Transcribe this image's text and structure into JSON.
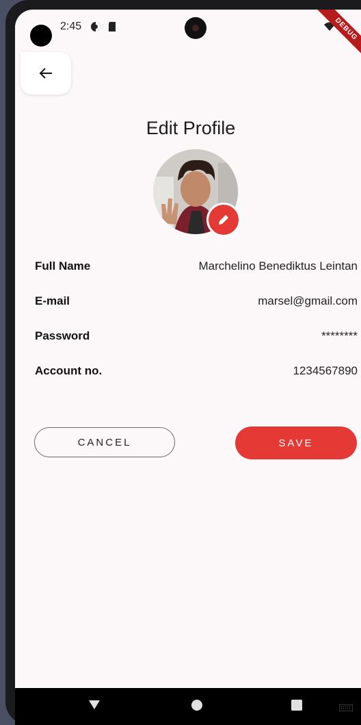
{
  "status_bar": {
    "time": "2:45",
    "debug_label": "DEBUG"
  },
  "header": {
    "title": "Edit Profile"
  },
  "profile": {
    "fields": [
      {
        "label": "Full Name",
        "value": "Marchelino Benediktus Leintan"
      },
      {
        "label": "E-mail",
        "value": "marsel@gmail.com"
      },
      {
        "label": "Password",
        "value": "********"
      },
      {
        "label": "Account no.",
        "value": "1234567890"
      }
    ]
  },
  "actions": {
    "cancel_label": "CANCEL",
    "save_label": "SAVE"
  },
  "colors": {
    "accent": "#e53935",
    "background": "#fcf8fa"
  }
}
